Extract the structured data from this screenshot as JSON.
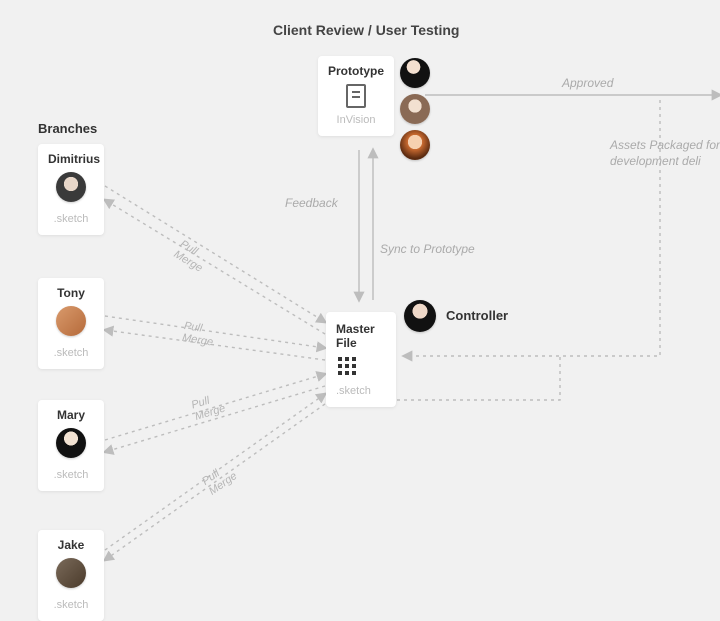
{
  "title": "Client Review / User Testing",
  "sections": {
    "branches": "Branches",
    "controller": "Controller"
  },
  "prototype": {
    "title": "Prototype",
    "tool": "InVision"
  },
  "master": {
    "title": "Master File",
    "ext": ".sketch"
  },
  "branches_list": [
    {
      "name": "Dimitrius",
      "ext": ".sketch"
    },
    {
      "name": "Tony",
      "ext": ".sketch"
    },
    {
      "name": "Mary",
      "ext": ".sketch"
    },
    {
      "name": "Jake",
      "ext": ".sketch"
    }
  ],
  "edges": {
    "approved": "Approved",
    "assets": "Assets Packaged for development deli",
    "feedback": "Feedback",
    "sync": "Sync to Prototype",
    "pull": "Pull",
    "merge": "Merge"
  }
}
